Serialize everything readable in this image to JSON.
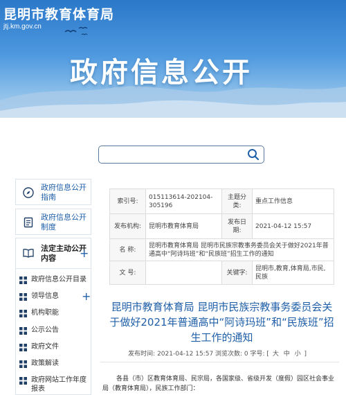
{
  "header": {
    "site_name": "昆明市教育体育局",
    "site_url": "jtj.km.gov.cn",
    "banner_title": "政府信息公开"
  },
  "search": {
    "placeholder": "",
    "value": ""
  },
  "sidebar": {
    "cards": [
      {
        "label": "政府信息公开指南",
        "icon": "compass-icon"
      },
      {
        "label": "政府信息公开制度",
        "icon": "document-icon"
      },
      {
        "label": "法定主动公开内容",
        "icon": "book-icon",
        "expand": "+"
      }
    ],
    "items": [
      {
        "label": "政府信息公开目录"
      },
      {
        "label": "领导信息",
        "expand": "+"
      },
      {
        "label": "机构职能"
      },
      {
        "label": "公示公告"
      },
      {
        "label": "政府文件"
      },
      {
        "label": "政策解读"
      },
      {
        "label": "政府网站工作年度报表"
      }
    ]
  },
  "info": {
    "index_key": "索引号:",
    "index_val": "015113614-202104-305196",
    "category_key": "主题分类:",
    "category_val": "重点工作信息",
    "org_key": "发布机构:",
    "org_val": "昆明市教育体育局",
    "date_key": "发布日期:",
    "date_val": "2021-04-12 15:57",
    "name_key": "名 称:",
    "name_val": "昆明市教育体育局 昆明市民族宗教事务委员会关于做好2021年普通高中“阿诗玛班”和“民族班”招生工作的通知",
    "docno_key": "文 号:",
    "docno_val": "",
    "keywords_key": "关键字:",
    "keywords_val": "昆明市,教育,体育局,市民,民族"
  },
  "article": {
    "title": "昆明市教育体育局 昆明市民族宗教事务委员会关于做好2021年普通高中“阿诗玛班”和“民族班”招生工作的通知",
    "meta_prefix": "发布时间: 2021-04-12 15:57 浏览次数: 0 字号:",
    "font_open": "[",
    "font_large": "大",
    "font_medium": "中",
    "font_small": "小",
    "font_close": "]",
    "body": "各县（市）区教育体育局、民宗局，各国家级、省级开发（度假）园区社会事业局（教育体育局），民族工作部门："
  },
  "colors": {
    "accent": "#1f5fa8",
    "banner": "#2b78c9"
  }
}
